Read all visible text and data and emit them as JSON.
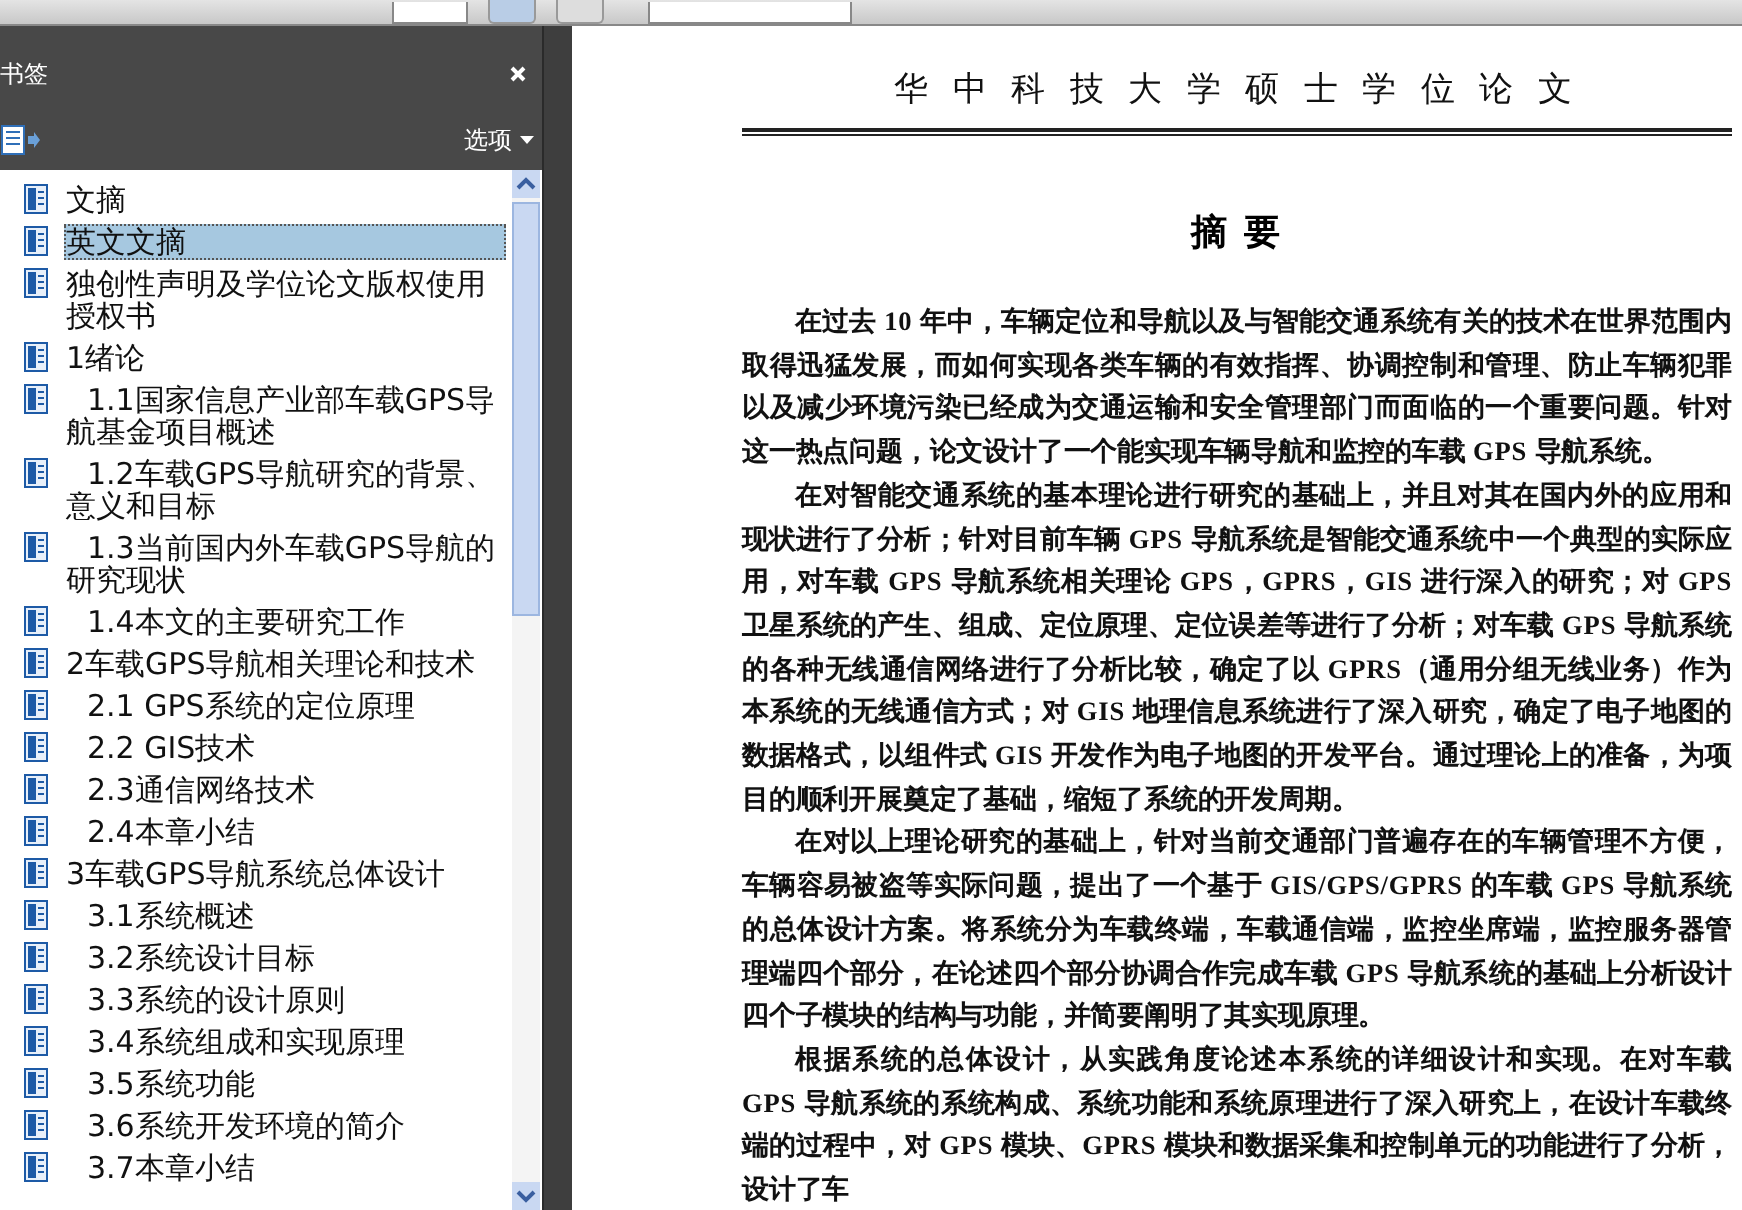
{
  "sidebar": {
    "title": "书签",
    "options_label": "选项",
    "bookmarks": [
      {
        "label": "文摘",
        "selected": false
      },
      {
        "label": "英文文摘",
        "selected": true
      },
      {
        "label": "独创性声明及学位论文版权使用授权书",
        "selected": false
      },
      {
        "label": "1绪论",
        "selected": false,
        "children": [
          {
            "label": "1.1国家信息产业部车载GPS导航基金项目概述",
            "selected": false
          },
          {
            "label": "1.2车载GPS导航研究的背景、意义和目标",
            "selected": false
          },
          {
            "label": "1.3当前国内外车载GPS导航的研究现状",
            "selected": false
          },
          {
            "label": "1.4本文的主要研究工作",
            "selected": false
          }
        ]
      },
      {
        "label": "2车载GPS导航相关理论和技术",
        "selected": false,
        "children": [
          {
            "label": "2.1 GPS系统的定位原理",
            "selected": false
          },
          {
            "label": "2.2 GIS技术",
            "selected": false
          },
          {
            "label": "2.3通信网络技术",
            "selected": false
          },
          {
            "label": "2.4本章小结",
            "selected": false
          }
        ]
      },
      {
        "label": "3车载GPS导航系统总体设计",
        "selected": false,
        "children": [
          {
            "label": "3.1系统概述",
            "selected": false
          },
          {
            "label": "3.2系统设计目标",
            "selected": false
          },
          {
            "label": "3.3系统的设计原则",
            "selected": false
          },
          {
            "label": "3.4系统组成和实现原理",
            "selected": false
          },
          {
            "label": "3.5系统功能",
            "selected": false
          },
          {
            "label": "3.6系统开发环境的简介",
            "selected": false
          },
          {
            "label": "3.7本章小结",
            "selected": false
          }
        ]
      }
    ]
  },
  "document": {
    "running_header": "华 中 科 技 大 学 硕 士 学 位 论 文",
    "heading": "摘  要",
    "paragraphs": [
      "在过去 10 年中，车辆定位和导航以及与智能交通系统有关的技术在世界范围内取得迅猛发展，而如何实现各类车辆的有效指挥、协调控制和管理、防止车辆犯罪以及减少环境污染已经成为交通运输和安全管理部门而面临的一个重要问题。针对这一热点问题，论文设计了一个能实现车辆导航和监控的车载 GPS 导航系统。",
      "在对智能交通系统的基本理论进行研究的基础上，并且对其在国内外的应用和现状进行了分析；针对目前车辆 GPS 导航系统是智能交通系统中一个典型的实际应用，对车载 GPS 导航系统相关理论 GPS，GPRS，GIS 进行深入的研究；对 GPS 卫星系统的产生、组成、定位原理、定位误差等进行了分析；对车载 GPS 导航系统的各种无线通信网络进行了分析比较，确定了以 GPRS（通用分组无线业务）作为本系统的无线通信方式；对 GIS 地理信息系统进行了深入研究，确定了电子地图的数据格式，以组件式 GIS 开发作为电子地图的开发平台。通过理论上的准备，为项目的顺利开展奠定了基础，缩短了系统的开发周期。",
      "在对以上理论研究的基础上，针对当前交通部门普遍存在的车辆管理不方便，车辆容易被盗等实际问题，提出了一个基于 GIS/GPS/GPRS 的车载 GPS 导航系统的总体设计方案。将系统分为车载终端，车载通信端，监控坐席端，监控服务器管理端四个部分，在论述四个部分协调合作完成车载 GPS 导航系统的基础上分析设计四个子模块的结构与功能，并简要阐明了其实现原理。",
      "根据系统的总体设计，从实践角度论述本系统的详细设计和实现。在对车载 GPS 导航系统的系统构成、系统功能和系统原理进行了深入研究上，在设计车载终端的过程中，对 GPS 模块、GPRS 模块和数据采集和控制单元的功能进行了分析，设计了车"
    ]
  }
}
